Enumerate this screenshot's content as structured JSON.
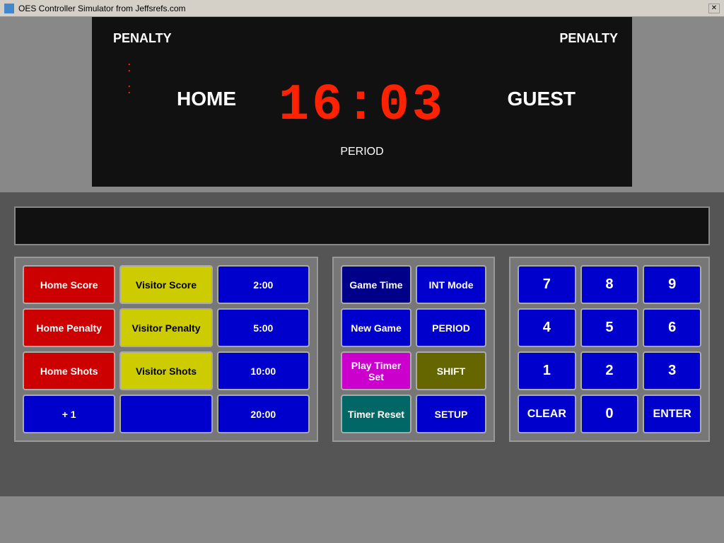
{
  "titlebar": {
    "title": "OES Controller Simulator from Jeffsrefs.com",
    "close_label": "✕"
  },
  "scoreboard": {
    "clock": "16:03",
    "home_label": "HOME",
    "guest_label": "GUEST",
    "period_label": "PERIOD",
    "penalty_left": "PENALTY",
    "penalty_right": "PENALTY",
    "dot1": ":",
    "dot2": ":"
  },
  "left_panel": {
    "home_score": "Home Score",
    "visitor_score": "Visitor Score",
    "time_2": "2:00",
    "home_penalty": "Home Penalty",
    "visitor_penalty": "Visitor Penalty",
    "time_5": "5:00",
    "home_shots": "Home Shots",
    "visitor_shots": "Visitor Shots",
    "time_10": "10:00",
    "plus1": "+ 1",
    "empty": "",
    "time_20": "20:00"
  },
  "middle_panel": {
    "game_time": "Game Time",
    "int_mode": "INT Mode",
    "new_game": "New Game",
    "period": "PERIOD",
    "play_timer_set": "Play Timer Set",
    "shift": "SHIFT",
    "timer_reset": "Timer Reset",
    "setup": "SETUP"
  },
  "right_panel": {
    "n7": "7",
    "n8": "8",
    "n9": "9",
    "n4": "4",
    "n5": "5",
    "n6": "6",
    "n1": "1",
    "n2": "2",
    "n3": "3",
    "clear": "CLEAR",
    "n0": "0",
    "enter": "ENTER"
  }
}
